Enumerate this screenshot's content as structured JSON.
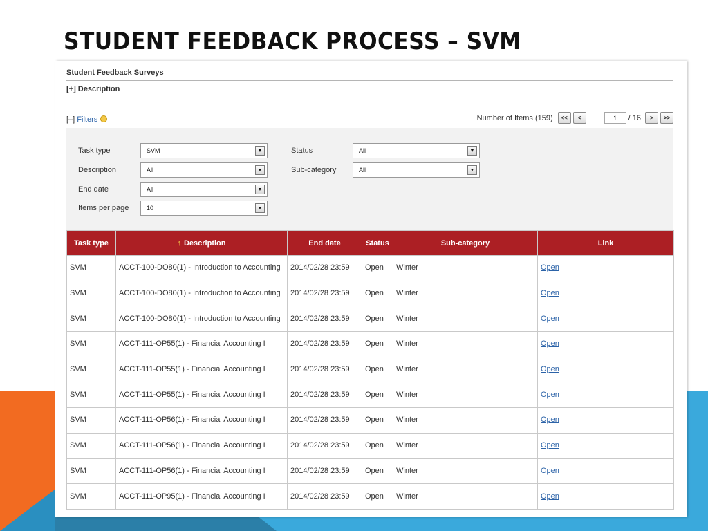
{
  "slide": {
    "title": "STUDENT FEEDBACK PROCESS – SVM"
  },
  "page": {
    "section_title": "Student Feedback Surveys",
    "description_toggle": "[+] Description",
    "filters_toggle_prefix": "[–] ",
    "filters_toggle_label": "Filters"
  },
  "pager": {
    "items_text": "Number of Items (159)",
    "first_label": "<<",
    "prev_label": "<",
    "current_page": "1",
    "total_text": "/ 16",
    "next_label": ">",
    "last_label": ">>"
  },
  "filters": {
    "task_type": {
      "label": "Task type",
      "value": "SVM"
    },
    "description": {
      "label": "Description",
      "value": "All"
    },
    "end_date": {
      "label": "End date",
      "value": "All"
    },
    "items_per_page": {
      "label": "Items per page",
      "value": "10"
    },
    "status": {
      "label": "Status",
      "value": "All"
    },
    "sub_category": {
      "label": "Sub-category",
      "value": "All"
    }
  },
  "table": {
    "columns": [
      "Task type",
      "Description",
      "End date",
      "Status",
      "Sub-category",
      "Link"
    ],
    "sort_indicator": "↑",
    "rows": [
      [
        "SVM",
        "ACCT-100-DO80(1) - Introduction to Accounting",
        "2014/02/28 23:59",
        "Open",
        "Winter",
        "Open"
      ],
      [
        "SVM",
        "ACCT-100-DO80(1) - Introduction to Accounting",
        "2014/02/28 23:59",
        "Open",
        "Winter",
        "Open"
      ],
      [
        "SVM",
        "ACCT-100-DO80(1) - Introduction to Accounting",
        "2014/02/28 23:59",
        "Open",
        "Winter",
        "Open"
      ],
      [
        "SVM",
        "ACCT-111-OP55(1) - Financial Accounting I",
        "2014/02/28 23:59",
        "Open",
        "Winter",
        "Open"
      ],
      [
        "SVM",
        "ACCT-111-OP55(1) - Financial Accounting I",
        "2014/02/28 23:59",
        "Open",
        "Winter",
        "Open"
      ],
      [
        "SVM",
        "ACCT-111-OP55(1) - Financial Accounting I",
        "2014/02/28 23:59",
        "Open",
        "Winter",
        "Open"
      ],
      [
        "SVM",
        "ACCT-111-OP56(1) - Financial Accounting I",
        "2014/02/28 23:59",
        "Open",
        "Winter",
        "Open"
      ],
      [
        "SVM",
        "ACCT-111-OP56(1) - Financial Accounting I",
        "2014/02/28 23:59",
        "Open",
        "Winter",
        "Open"
      ],
      [
        "SVM",
        "ACCT-111-OP56(1) - Financial Accounting I",
        "2014/02/28 23:59",
        "Open",
        "Winter",
        "Open"
      ],
      [
        "SVM",
        "ACCT-111-OP95(1) - Financial Accounting I",
        "2014/02/28 23:59",
        "Open",
        "Winter",
        "Open"
      ]
    ]
  },
  "colors": {
    "header_red": "#ac1f24",
    "link_blue": "#2c63a8",
    "accent_orange": "#f26b21",
    "accent_blue": "#3aa9dc"
  },
  "icons": {
    "filters_help": "help-icon",
    "select_arrow": "dropdown-arrow-icon",
    "sort": "sort-ascending-icon"
  }
}
